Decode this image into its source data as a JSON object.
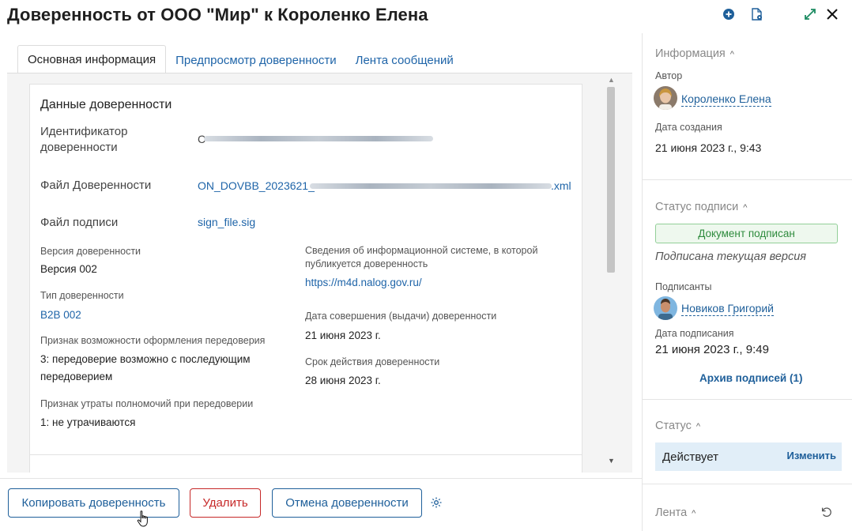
{
  "header": {
    "title": "Доверенность от ООО \"Мир\" к Короленко Елена",
    "icons": [
      "plus-circle-icon",
      "document-settings-icon",
      "expand-icon",
      "close-icon"
    ]
  },
  "tabs": [
    {
      "label": "Основная информация",
      "active": true
    },
    {
      "label": "Предпросмотр доверенности",
      "active": false
    },
    {
      "label": "Лента сообщений",
      "active": false
    }
  ],
  "details": {
    "section_title": "Данные доверенности",
    "identifier_label": "Идентификатор доверенности",
    "identifier_value_prefix": "C",
    "file_label": "Файл Доверенности",
    "file_value_prefix": "ON_DOVBB_2023621_",
    "file_value_suffix": ".xml",
    "sign_file_label": "Файл подписи",
    "sign_file_value": "sign_file.sig",
    "version_label": "Версия доверенности",
    "version_value": "Версия 002",
    "type_label": "Тип доверенности",
    "type_value": "B2B 002",
    "redelegation_label": "Признак возможности оформления передоверия",
    "redelegation_value": "3: передоверие возможно с последующим передоверием",
    "loss_label": "Признак утраты полномочий при передоверии",
    "loss_value": "1: не утрачиваются",
    "infosys_label": "Сведения об информационной системе, в которой публикуется доверенность",
    "infosys_value": "https://m4d.nalog.gov.ru/",
    "issue_date_label": "Дата совершения (выдачи) доверенности",
    "issue_date_value": "21 июня 2023 г.",
    "expiry_label": "Срок действия доверенности",
    "expiry_value": "28 июня 2023 г."
  },
  "actions": {
    "copy": "Копировать доверенность",
    "delete": "Удалить",
    "cancel": "Отмена доверенности"
  },
  "sidebar": {
    "info_title": "Информация",
    "author_label": "Автор",
    "author_name": "Короленко Елена",
    "created_label": "Дата создания",
    "created_value": "21 июня 2023 г., 9:43",
    "sign_status_title": "Статус подписи",
    "sign_status_badge": "Документ подписан",
    "sign_status_note": "Подписана текущая версия",
    "signers_label": "Подписанты",
    "signer_name": "Новиков Григорий",
    "signed_date_label": "Дата подписания",
    "signed_date_value": "21 июня 2023 г., 9:49",
    "archive_link": "Архив подписей (1)",
    "status_title": "Статус",
    "status_value": "Действует",
    "status_change": "Изменить",
    "feed_title": "Лента"
  },
  "colors": {
    "link": "#1e64a8",
    "primary": "#1e5f9a",
    "danger": "#c62828",
    "success": "#2e8b3d",
    "status_bg": "#e1eef8"
  }
}
